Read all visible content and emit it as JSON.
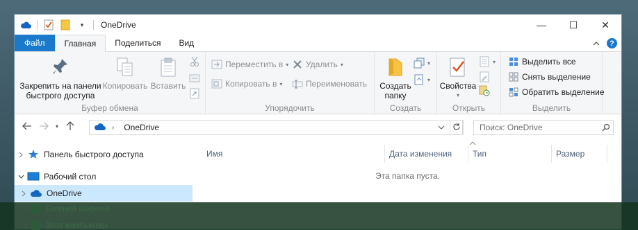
{
  "window": {
    "title": "OneDrive"
  },
  "window_controls": {
    "minimize": "—",
    "maximize": "☐",
    "close": "✕"
  },
  "tabs": [
    {
      "label": "Файл"
    },
    {
      "label": "Главная"
    },
    {
      "label": "Поделиться"
    },
    {
      "label": "Вид"
    }
  ],
  "tab_right": {
    "collapse": "^",
    "help": "?"
  },
  "ribbon": {
    "clipboard": {
      "label": "Буфер обмена",
      "pin": "Закрепить на панели быстрого доступа",
      "pin_line1": "Закрепить на панели",
      "pin_line2": "быстрого доступа",
      "copy": "Копировать",
      "paste": "Вставить"
    },
    "organize": {
      "label": "Упорядочить",
      "move_to": "Переместить в",
      "copy_to": "Копировать в",
      "delete": "Удалить",
      "rename": "Переименовать"
    },
    "new": {
      "label": "Создать",
      "new_folder_line1": "Создать",
      "new_folder_line2": "папку"
    },
    "open": {
      "label": "Открыть",
      "properties": "Свойства"
    },
    "select": {
      "label": "Выделить",
      "select_all": "Выделить все",
      "select_none": "Снять выделение",
      "invert": "Обратить выделение"
    }
  },
  "address": {
    "location": "OneDrive"
  },
  "search": {
    "placeholder": "Поиск: OneDrive"
  },
  "nav_pane": {
    "items": [
      {
        "label": "Панель быстрого доступа"
      },
      {
        "label": "Рабочий стол"
      },
      {
        "label": "OneDrive"
      },
      {
        "label": "Евгений Ширяев"
      },
      {
        "label": "Этот компьютер"
      }
    ]
  },
  "columns": [
    {
      "label": "Имя"
    },
    {
      "label": "Дата изменения"
    },
    {
      "label": "Тип"
    },
    {
      "label": "Размер"
    }
  ],
  "empty_message": "Эта папка пуста."
}
